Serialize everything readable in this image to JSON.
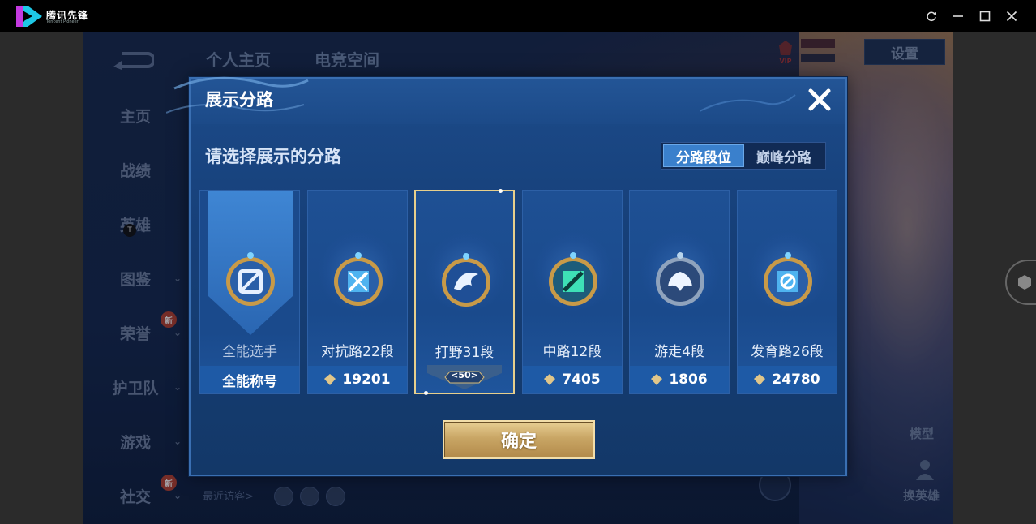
{
  "window": {
    "app_name": "腾讯先锋",
    "app_subtitle": "Tencent Pioneer",
    "controls": [
      "refresh-icon",
      "minimize-icon",
      "maximize-icon",
      "close-icon"
    ]
  },
  "background_page": {
    "top_tabs": [
      "个人主页",
      "电竞空间"
    ],
    "side_nav": [
      {
        "label": "主页",
        "chevron": false,
        "badge": ""
      },
      {
        "label": "战绩",
        "chevron": false,
        "badge": ""
      },
      {
        "label": "英雄",
        "chevron": false,
        "badge": ""
      },
      {
        "label": "图鉴",
        "chevron": true,
        "badge": ""
      },
      {
        "label": "荣誉",
        "chevron": true,
        "badge": "新"
      },
      {
        "label": "护卫队",
        "chevron": true,
        "badge": ""
      },
      {
        "label": "游戏",
        "chevron": true,
        "badge": ""
      },
      {
        "label": "社交",
        "chevron": true,
        "badge": "新"
      }
    ],
    "cursor_glyph": "T",
    "recent_visitors": "最近访客>",
    "settings": "设置",
    "model_label": "模型",
    "switch_hero_label": "换英雄",
    "vip_label": "VIP"
  },
  "modal": {
    "title": "展示分路",
    "prompt": "请选择展示的分路",
    "tabs": [
      {
        "label": "分路段位",
        "active": true
      },
      {
        "label": "巅峰分路",
        "active": false
      }
    ],
    "cards": [
      {
        "name": "全能选手",
        "footer": "全能称号",
        "points": "",
        "selected": false,
        "emblem": "allround-emblem-icon"
      },
      {
        "name": "对抗路22段",
        "footer": "",
        "points": "19201",
        "selected": false,
        "emblem": "clash-lane-emblem-icon"
      },
      {
        "name": "打野31段",
        "footer": "",
        "points": "",
        "selected": true,
        "level": "50",
        "emblem": "jungle-emblem-icon"
      },
      {
        "name": "中路12段",
        "footer": "",
        "points": "7405",
        "selected": false,
        "emblem": "mid-lane-emblem-icon"
      },
      {
        "name": "游走4段",
        "footer": "",
        "points": "1806",
        "selected": false,
        "emblem": "roam-emblem-icon"
      },
      {
        "name": "发育路26段",
        "footer": "",
        "points": "24780",
        "selected": false,
        "emblem": "farm-lane-emblem-icon"
      }
    ],
    "confirm": "确定"
  },
  "colors": {
    "modal_bg": "#1c4b8a",
    "active_tab": "#3a80cc",
    "gold": "#e7cf8c",
    "confirm_gold": "#c9a665"
  }
}
